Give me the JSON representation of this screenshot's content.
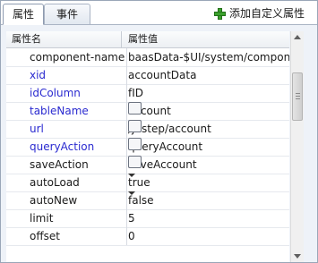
{
  "tabs": [
    {
      "label": "属性"
    },
    {
      "label": "事件"
    }
  ],
  "add_button": {
    "label": "添加自定义属性",
    "icon": "plus-icon"
  },
  "grid": {
    "headers": {
      "name": "属性名",
      "value": "属性值"
    },
    "rows": [
      {
        "name": "component-name",
        "value": "baasData-$UI/system/compon",
        "blue": false,
        "control": "none"
      },
      {
        "name": "xid",
        "value": "accountData",
        "blue": true,
        "control": "none"
      },
      {
        "name": "idColumn",
        "value": "fID",
        "blue": true,
        "control": "none"
      },
      {
        "name": "tableName",
        "value": "account",
        "blue": true,
        "control": "ellipsis"
      },
      {
        "name": "url",
        "value": "/justep/account",
        "blue": true,
        "control": "ellipsis"
      },
      {
        "name": "queryAction",
        "value": "queryAccount",
        "blue": true,
        "control": "ellipsis"
      },
      {
        "name": "saveAction",
        "value": "saveAccount",
        "blue": false,
        "control": "ellipsis"
      },
      {
        "name": "autoLoad",
        "value": "true",
        "blue": false,
        "control": "dropdown"
      },
      {
        "name": "autoNew",
        "value": "false",
        "blue": false,
        "control": "dropdown"
      },
      {
        "name": "limit",
        "value": "5",
        "blue": false,
        "control": "none"
      },
      {
        "name": "offset",
        "value": "0",
        "blue": false,
        "control": "none"
      }
    ]
  },
  "ellipsis_label": "...",
  "colors": {
    "blue_name": "#2a2ad0",
    "accent_green": "#3aa12c"
  }
}
